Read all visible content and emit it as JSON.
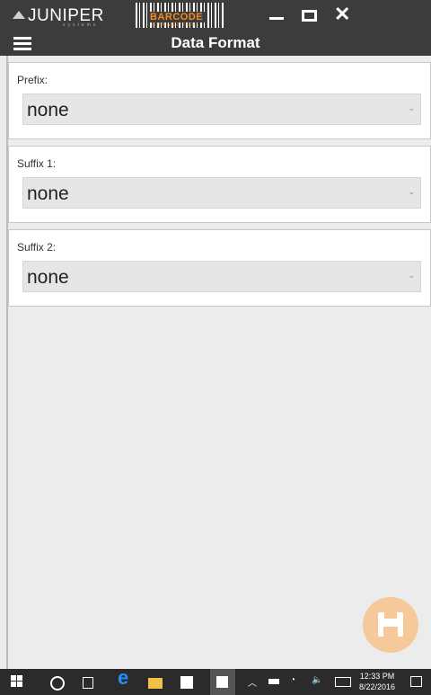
{
  "window": {
    "brand": "JUNIPER",
    "brand_sub": "systems",
    "barcode_label": "BARCODE",
    "barcode_sub": "CONNECTOR",
    "controls": [
      "minimize-icon",
      "maximize-icon",
      "close-icon"
    ]
  },
  "appbar": {
    "title": "Data Format",
    "menu_icon": "hamburger-icon"
  },
  "fields": [
    {
      "label": "Prefix:",
      "value": "none"
    },
    {
      "label": "Suffix 1:",
      "value": "none"
    },
    {
      "label": "Suffix 2:",
      "value": "none"
    }
  ],
  "fab": {
    "icon": "save-icon",
    "color": "#f5c99a"
  },
  "colors": {
    "titlebar": "#3c3c3c",
    "accent": "#f58a1f",
    "background": "#ececec"
  },
  "taskbar": {
    "time": "12:33 PM",
    "date": "8/22/2016",
    "icons": [
      "start-icon",
      "cortana-icon",
      "task-view-icon",
      "edge-icon",
      "file-explorer-icon",
      "store-icon",
      "barcode-app-icon",
      "chevron-up-icon",
      "battery-icon",
      "wifi-icon",
      "volume-icon",
      "keyboard-icon",
      "notification-icon"
    ]
  }
}
